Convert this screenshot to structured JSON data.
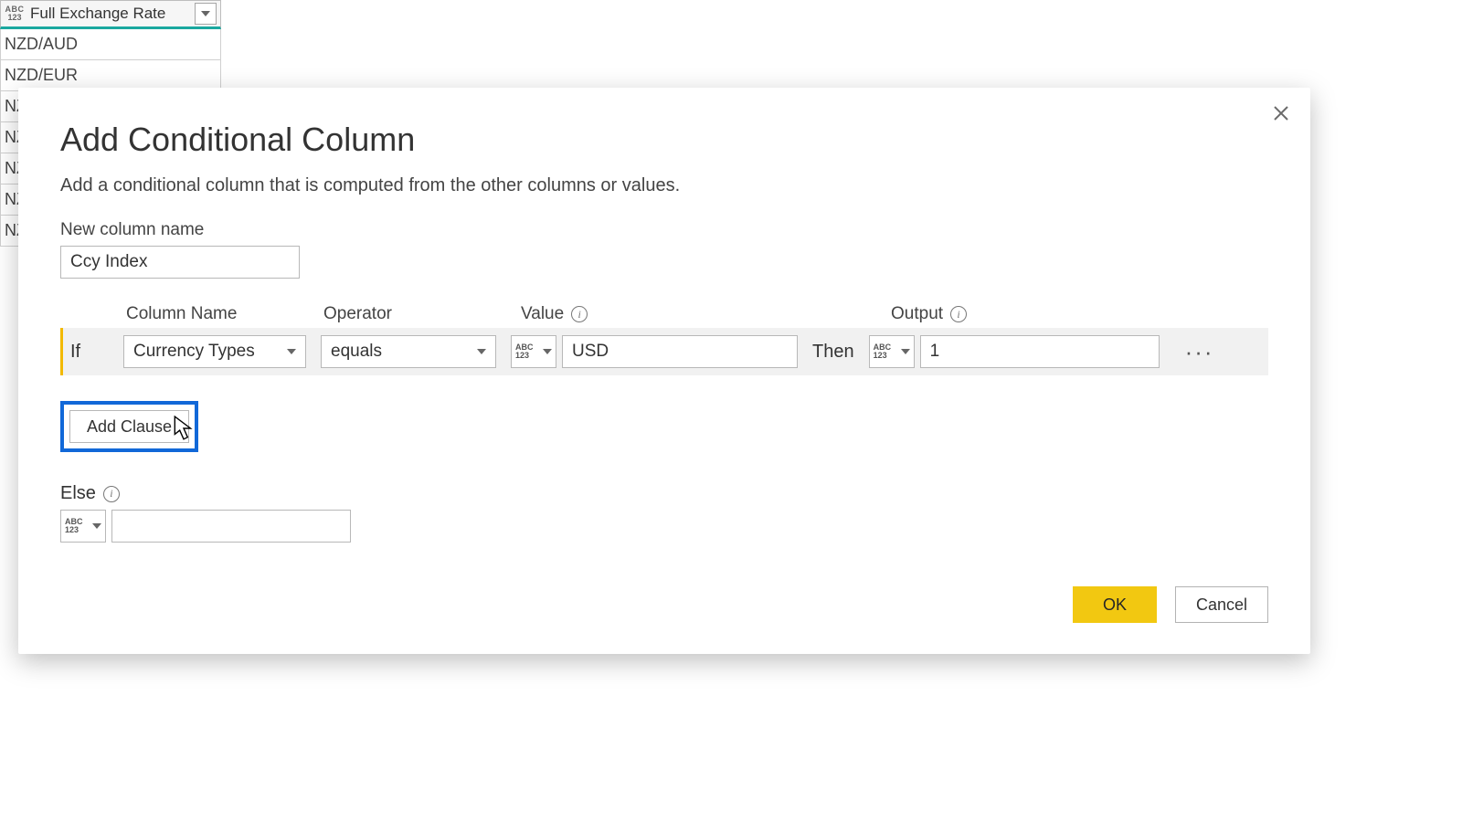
{
  "background": {
    "column_type_badge": {
      "line1": "ABC",
      "line2": "123"
    },
    "column_name": "Full Exchange Rate",
    "rows": [
      "NZD/AUD",
      "NZD/EUR",
      "NZ",
      "NZ",
      "NZ",
      "NZ",
      "NZ"
    ]
  },
  "dialog": {
    "title": "Add Conditional Column",
    "subtitle": "Add a conditional column that is computed from the other columns or values.",
    "new_column_label": "New column name",
    "new_column_value": "Ccy Index",
    "headers": {
      "column": "Column Name",
      "operator": "Operator",
      "value": "Value",
      "output": "Output"
    },
    "clause": {
      "if_label": "If",
      "column_value": "Currency Types",
      "operator_value": "equals",
      "value_type_badge": {
        "line1": "ABC",
        "line2": "123"
      },
      "value_value": "USD",
      "then_label": "Then",
      "output_type_badge": {
        "line1": "ABC",
        "line2": "123"
      },
      "output_value": "1",
      "more_label": "···"
    },
    "add_clause": "Add Clause",
    "else_label": "Else",
    "else_type_badge": {
      "line1": "ABC",
      "line2": "123"
    },
    "else_value": "",
    "ok": "OK",
    "cancel": "Cancel"
  }
}
